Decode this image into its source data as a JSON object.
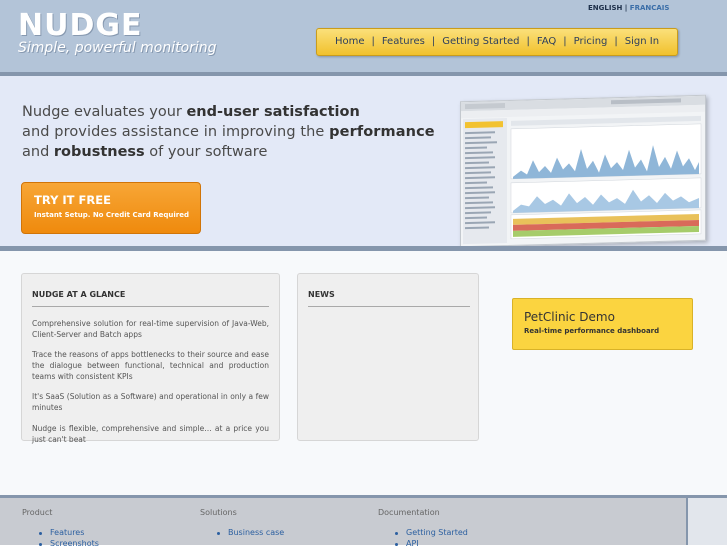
{
  "header": {
    "logo": "NUDGE",
    "tagline": "Simple, powerful monitoring",
    "lang_en": "ENGLISH",
    "lang_sep": "|",
    "lang_fr": "FRANCAIS",
    "nav": [
      "Home",
      "Features",
      "Getting Started",
      "FAQ",
      "Pricing",
      "Sign In"
    ],
    "nav_sep": "|"
  },
  "hero": {
    "line1_pre": "Nudge evaluates your ",
    "line1_bold": "end-user satisfaction",
    "line2_pre": "and provides assistance in improving the ",
    "line2_bold": "performance",
    "line3_pre": "and ",
    "line3_bold": "robustness",
    "line3_post": " of your software",
    "try_title": "TRY IT FREE",
    "try_sub": "Instant Setup. No Credit Card Required"
  },
  "glance": {
    "title": "NUDGE AT A GLANCE",
    "p1": "Comprehensive solution for real-time supervision of Java-Web, Client-Server and Batch apps",
    "p2": "Trace the reasons of apps bottlenecks to their source and ease the dialogue between functional, technical and production teams with consistent KPIs",
    "p3": "It's SaaS (Solution as a Software) and operational in only a few minutes",
    "p4": "Nudge is flexible, comprehensive and simple… at a price you just can't beat"
  },
  "news": {
    "title": "NEWS"
  },
  "demo": {
    "title": "PetClinic Demo",
    "subtitle": "Real-time performance dashboard"
  },
  "footer": {
    "col1": {
      "title": "Product",
      "links": [
        "Features",
        "Screenshots"
      ]
    },
    "col2": {
      "title": "Solutions",
      "links": [
        "Business case"
      ]
    },
    "col3": {
      "title": "Documentation",
      "links": [
        "Getting Started",
        "API"
      ]
    }
  },
  "colors": {
    "header_bg": "#b3c4d8",
    "hero_bg": "#e3e9f7",
    "nav_yellow": "#f1c12c",
    "try_orange": "#ef8a0d",
    "demo_yellow": "#fbd440",
    "link_blue": "#2b5fa0"
  }
}
